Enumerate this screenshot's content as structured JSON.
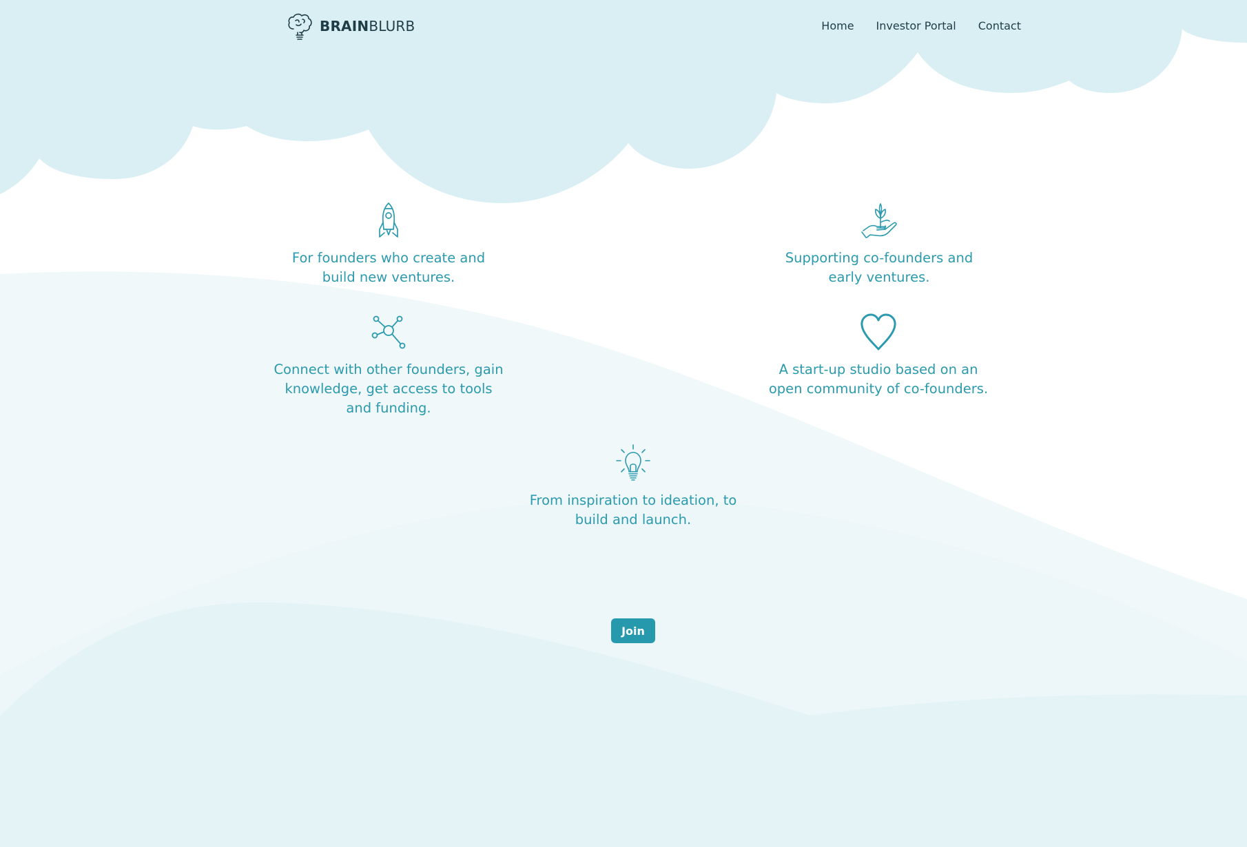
{
  "header": {
    "brand_bold": "BRAIN",
    "brand_light": "BLURB",
    "logo_icon": "brain-lightbulb-icon",
    "nav": [
      {
        "label": "Home"
      },
      {
        "label": "Investor Portal"
      },
      {
        "label": "Contact"
      }
    ]
  },
  "features": [
    {
      "icon": "rocket-icon",
      "text": "For founders who create and build new ventures."
    },
    {
      "icon": "hand-plant-icon",
      "text": "Supporting co-founders and early ventures."
    },
    {
      "icon": "network-icon",
      "text": "Connect with other founders, gain knowledge, get access to tools and funding."
    },
    {
      "icon": "heart-icon",
      "text": "A start-up studio based on an open community of co-founders."
    },
    {
      "icon": "lightbulb-icon",
      "text": "From inspiration to ideation, to build and launch."
    }
  ],
  "cta": {
    "join_label": "Join"
  },
  "colors": {
    "accent": "#2699ad",
    "text_teal": "#2b9aad",
    "cloud": "#d9eff3",
    "wave_light": "#eff8fa",
    "wave_mid": "#e2f2f5",
    "nav_text": "#1f3d47"
  }
}
